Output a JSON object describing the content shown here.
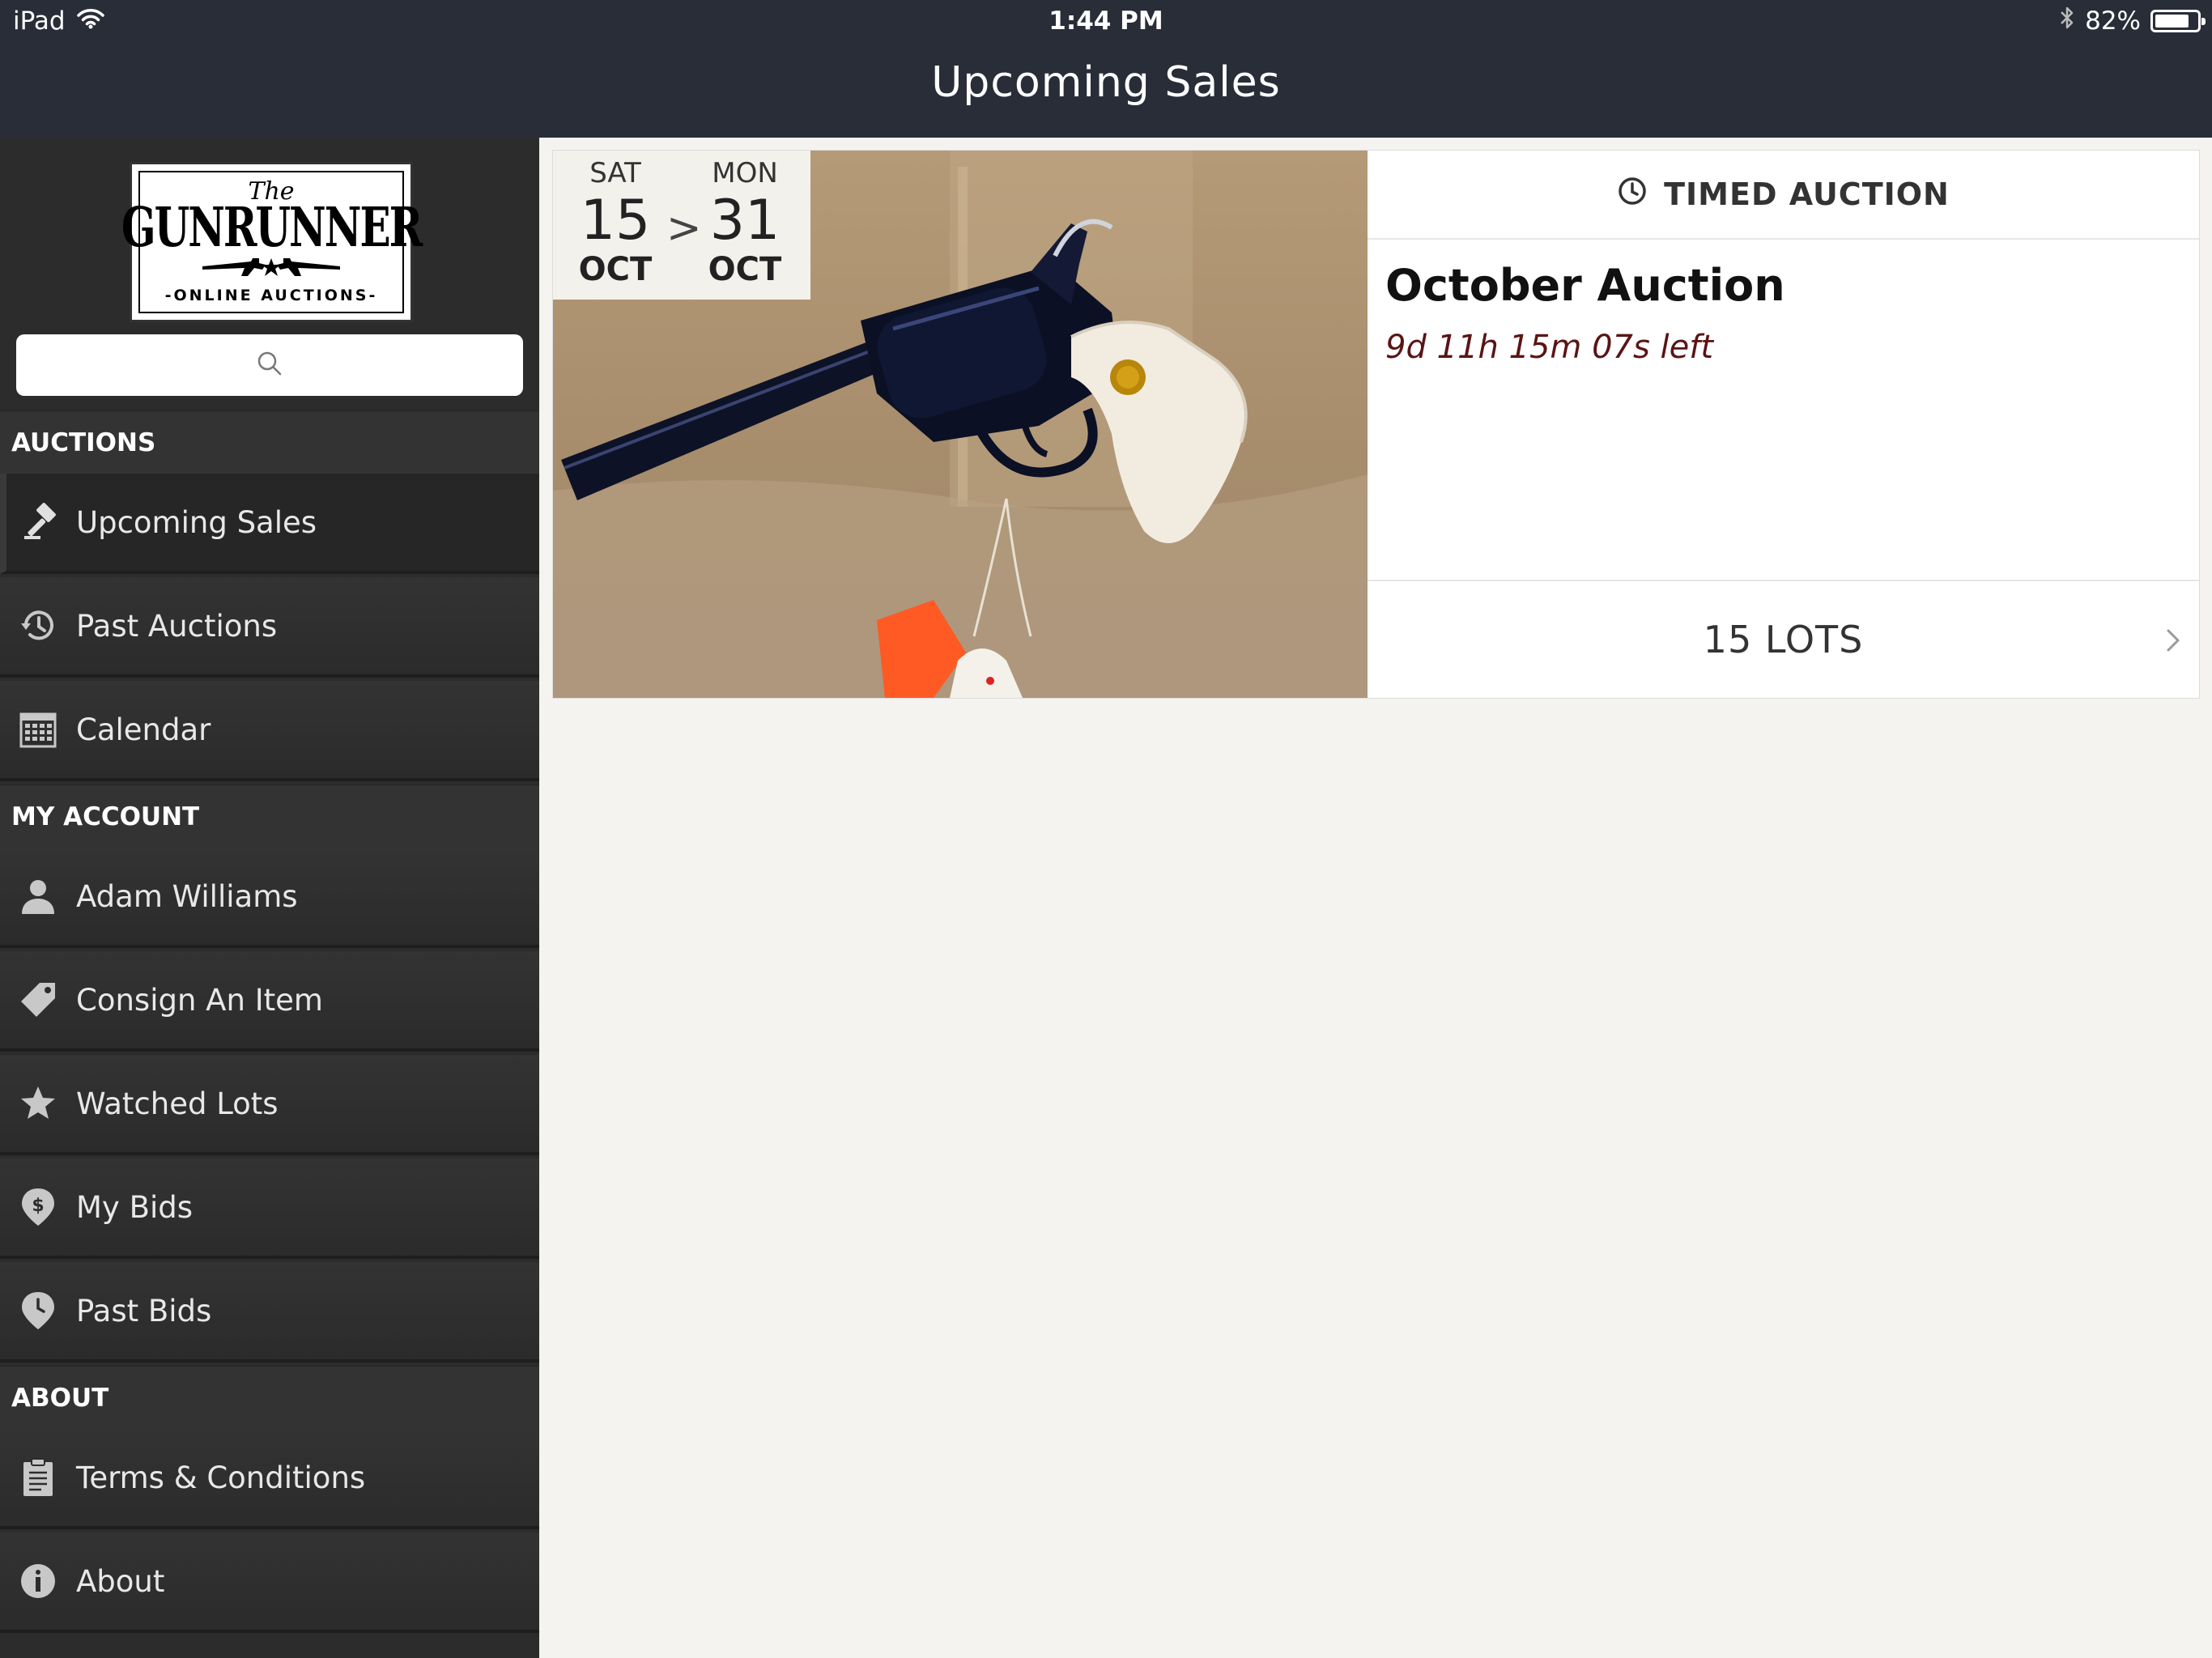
{
  "status_bar": {
    "device": "iPad",
    "time": "1:44 PM",
    "battery": "82%",
    "battery_level": 0.82,
    "icons": [
      "wifi-icon",
      "bluetooth-icon",
      "battery-icon"
    ]
  },
  "header": {
    "title": "Upcoming Sales"
  },
  "sidebar": {
    "logo": {
      "the": "The",
      "name": "GUNRUNNER",
      "subtitle": "-ONLINE AUCTIONS-"
    },
    "search": {
      "icon": "search-icon",
      "value": ""
    },
    "sections": {
      "auctions": "AUCTIONS",
      "my_account": "MY ACCOUNT",
      "about": "ABOUT"
    },
    "items": {
      "upcoming_sales": {
        "label": "Upcoming Sales",
        "icon": "gavel-icon"
      },
      "past_auctions": {
        "label": "Past Auctions",
        "icon": "history-icon"
      },
      "calendar": {
        "label": "Calendar",
        "icon": "calendar-icon"
      },
      "account_user": {
        "label": "Adam Williams",
        "icon": "user-icon"
      },
      "consign": {
        "label": "Consign An Item",
        "icon": "tag-icon"
      },
      "watched": {
        "label": "Watched Lots",
        "icon": "star-icon"
      },
      "my_bids": {
        "label": "My Bids",
        "icon": "dollar-pin-icon"
      },
      "past_bids": {
        "label": "Past Bids",
        "icon": "clock-pin-icon"
      },
      "terms": {
        "label": "Terms & Conditions",
        "icon": "clipboard-icon"
      },
      "about": {
        "label": "About",
        "icon": "info-icon"
      }
    }
  },
  "auction": {
    "start": {
      "dow": "SAT",
      "day": "15",
      "month": "OCT"
    },
    "end": {
      "dow": "MON",
      "day": "31",
      "month": "OCT"
    },
    "range_separator": ">",
    "type": "TIMED AUCTION",
    "type_icon": "clock-icon",
    "name": "October Auction",
    "time_left": "9d 11h 15m 07s left",
    "lots": "15 LOTS",
    "image": "revolver-photo"
  },
  "colors": {
    "topbar": "#282d38",
    "sidebar": "#2c2c2c",
    "content_bg": "#f4f3ef",
    "time_left": "#5a1414"
  }
}
